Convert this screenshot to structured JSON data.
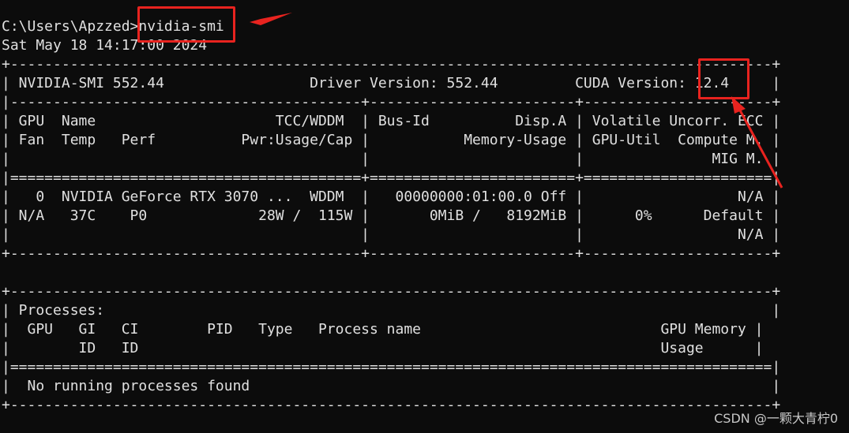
{
  "terminal": {
    "lines": [
      "C:\\Users\\Apzzed>nvidia-smi",
      "Sat May 18 14:17:00 2024",
      "+-----------------------------------------------------------------------------------------+",
      "| NVIDIA-SMI 552.44                 Driver Version: 552.44         CUDA Version: 12.4     |",
      "|-----------------------------------------+------------------------+----------------------+",
      "| GPU  Name                     TCC/WDDM  | Bus-Id          Disp.A | Volatile Uncorr. ECC |",
      "| Fan  Temp   Perf          Pwr:Usage/Cap |           Memory-Usage | GPU-Util  Compute M. |",
      "|                                         |                        |               MIG M. |",
      "|=========================================+========================+======================|",
      "|   0  NVIDIA GeForce RTX 3070 ...  WDDM  |   00000000:01:00.0 Off |                  N/A |",
      "| N/A   37C    P0             28W /  115W |       0MiB /   8192MiB |      0%      Default |",
      "|                                         |                        |                  N/A |",
      "+-----------------------------------------+------------------------+----------------------+",
      "",
      "+-----------------------------------------------------------------------------------------+",
      "| Processes:                                                                              |",
      "|  GPU   GI   CI        PID   Type   Process name                            GPU Memory |",
      "|        ID   ID                                                             Usage      |",
      "|=========================================================================================|",
      "|  No running processes found                                                             |",
      "+-----------------------------------------------------------------------------------------+"
    ]
  },
  "annotations": {
    "highlight_color": "#e8231f",
    "highlighted_command": "nvidia-smi",
    "highlighted_cuda_version": "12.4"
  },
  "watermark": "CSDN @一颗大青柠0"
}
